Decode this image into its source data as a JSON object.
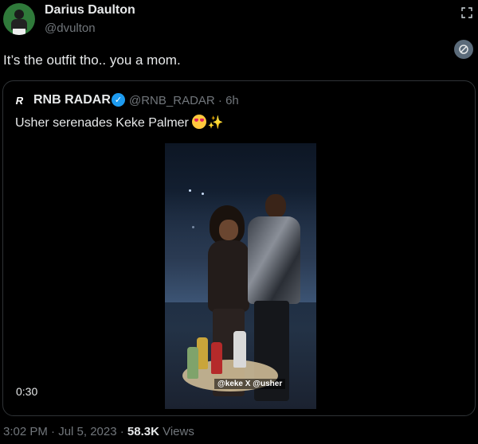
{
  "author": {
    "display_name": "Darius Daulton",
    "handle": "@dvulton"
  },
  "tweet": {
    "text": "It’s the outfit tho.. you a mom."
  },
  "quote": {
    "display_name": "RNB RADAR",
    "handle_time": "@RNB_RADAR · 6h",
    "text": "Usher serenades Keke Palmer",
    "video": {
      "caption": "@keke X @usher",
      "duration": "0:30"
    }
  },
  "footer": {
    "timestamp": "3:02 PM · Jul 5, 2023 · ",
    "views_count": "58.3K",
    "views_label": " Views"
  },
  "icons": {
    "expand": "expand-icon",
    "grok": "grok-icon",
    "verified": "verified-badge-icon"
  }
}
